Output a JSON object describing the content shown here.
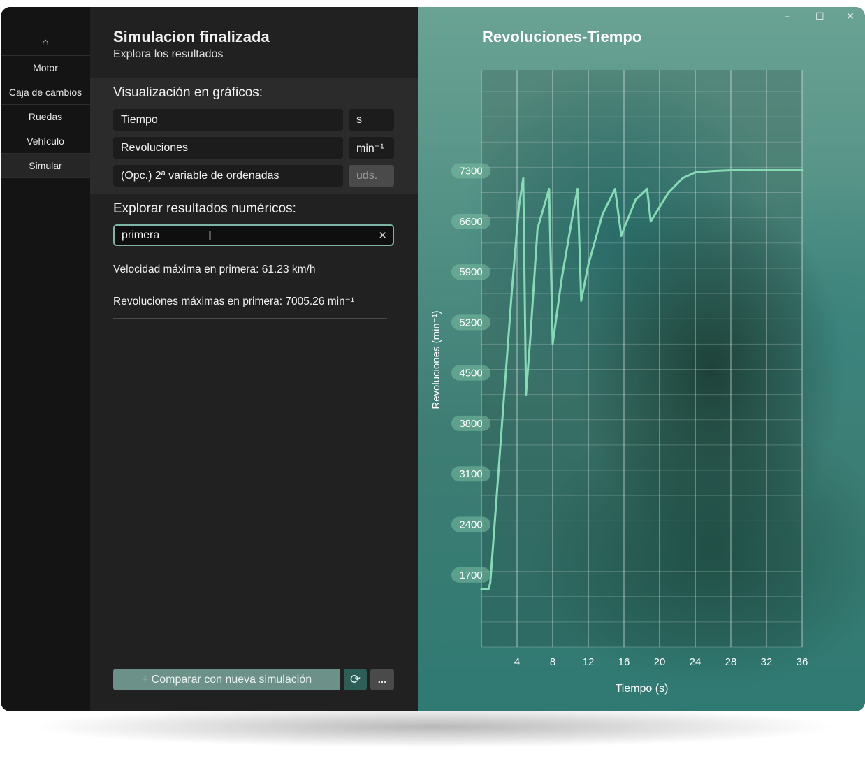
{
  "sidebar": {
    "home_icon": "⌂",
    "items": [
      "Motor",
      "Caja de cambios",
      "Ruedas",
      "Vehículo",
      "Simular"
    ],
    "active": "Simular"
  },
  "header": {
    "title": "Simulacion finalizada",
    "subtitle": "Explora los resultados"
  },
  "graphs": {
    "heading": "Visualización en gráficos:",
    "x_variable": "Tiempo",
    "x_unit": "s",
    "y_variable": "Revoluciones",
    "y_unit": "min⁻¹",
    "y2_variable": "(Opc.) 2ª variable de ordenadas",
    "y2_unit": "uds."
  },
  "numeric": {
    "heading": "Explorar resultados numéricos:",
    "search_value": "primera",
    "results": [
      "Velocidad máxima en primera: 61.23 km/h",
      "Revoluciones máximas en primera: 7005.26 min⁻¹"
    ]
  },
  "actions": {
    "compare_label": "+ Comparar con nueva simulación",
    "reload_icon": "⟳",
    "more_label": "..."
  },
  "window_controls": {
    "minimize": "–",
    "maximize": "☐",
    "close": "✕"
  },
  "colors": {
    "accent": "#7fd8b2",
    "line": "#86dbb6",
    "panel_dark": "#212121",
    "sidebar": "#141414"
  },
  "chart_data": {
    "type": "line",
    "title": "Revoluciones-Tiempo",
    "xlabel": "Tiempo (s)",
    "ylabel": "Revoluciones (min⁻¹)",
    "xlim": [
      0,
      36
    ],
    "ylim": [
      700,
      8700
    ],
    "x_ticks": [
      4,
      8,
      12,
      16,
      20,
      24,
      28,
      32,
      36
    ],
    "y_ticks": [
      1700,
      2400,
      3100,
      3800,
      4500,
      5200,
      5900,
      6600,
      7300
    ],
    "grid": true,
    "series": [
      {
        "x": [
          0.0,
          0.8,
          1.0,
          2.2,
          3.4,
          4.2,
          4.7,
          5.0,
          5.5,
          6.3,
          7.6,
          8.0,
          9.0,
          10.4,
          10.8,
          11.2,
          12.0,
          13.6,
          15.0,
          15.7,
          16.0,
          17.3,
          18.6,
          19.0,
          19.5,
          21.0,
          22.6,
          24.0,
          26.0,
          28.0,
          30.0,
          36.0
        ],
        "y": [
          1500,
          1500,
          1600,
          3600,
          5600,
          6800,
          7200,
          4200,
          5000,
          6500,
          7050,
          4900,
          5800,
          6800,
          7050,
          5500,
          6000,
          6700,
          7050,
          6400,
          6500,
          6900,
          7050,
          6600,
          6700,
          7000,
          7200,
          7280,
          7300,
          7310,
          7310,
          7310
        ]
      }
    ]
  }
}
